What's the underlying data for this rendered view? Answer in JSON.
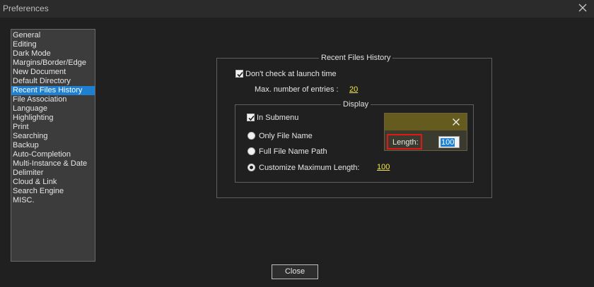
{
  "window": {
    "title": "Preferences",
    "close_icon": "close-icon"
  },
  "sidebar": {
    "selected_index": 6,
    "items": [
      "General",
      "Editing",
      "Dark Mode",
      "Margins/Border/Edge",
      "New Document",
      "Default Directory",
      "Recent Files History",
      "File Association",
      "Language",
      "Highlighting",
      "Print",
      "Searching",
      "Backup",
      "Auto-Completion",
      "Multi-Instance & Date",
      "Delimiter",
      "Cloud & Link",
      "Search Engine",
      "MISC."
    ]
  },
  "recent": {
    "group_title": "Recent Files History",
    "dont_check_label": "Don't check at launch time",
    "dont_check_checked": true,
    "max_entries_label": "Max. number of entries :",
    "max_entries_value": "20",
    "display": {
      "group_title": "Display",
      "in_submenu_label": "In Submenu",
      "in_submenu_checked": true,
      "radio_only_name": "Only File Name",
      "radio_full_path": "Full File Name Path",
      "radio_custom": "Customize Maximum Length:",
      "selected_radio": "custom",
      "custom_length_value": "100"
    }
  },
  "popup": {
    "length_label": "Length:",
    "length_value": "100"
  },
  "footer": {
    "close_label": "Close"
  },
  "colors": {
    "background": "#202020",
    "selection": "#1f7fd0",
    "link": "#f2e84a",
    "popup_header": "#665b1e",
    "highlight_border": "#e01818"
  }
}
